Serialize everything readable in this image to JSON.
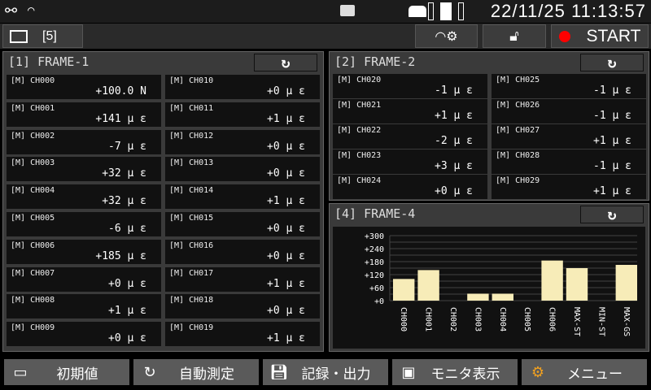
{
  "status": {
    "datetime": "22/11/25 11:13:57"
  },
  "toolbar": {
    "monitor_label": "[5]",
    "start_label": "START"
  },
  "frame1": {
    "title": "[1] FRAME-1",
    "cells": [
      {
        "name": "[M] CH000",
        "value": "+100.0 N"
      },
      {
        "name": "[M] CH001",
        "value": "+141 μ ε"
      },
      {
        "name": "[M] CH002",
        "value": "-7 μ ε"
      },
      {
        "name": "[M] CH003",
        "value": "+32 μ ε"
      },
      {
        "name": "[M] CH004",
        "value": "+32 μ ε"
      },
      {
        "name": "[M] CH005",
        "value": "-6 μ ε"
      },
      {
        "name": "[M] CH006",
        "value": "+185 μ ε"
      },
      {
        "name": "[M] CH007",
        "value": "+0 μ ε"
      },
      {
        "name": "[M] CH008",
        "value": "+1 μ ε"
      },
      {
        "name": "[M] CH009",
        "value": "+0 μ ε"
      },
      {
        "name": "[M] CH010",
        "value": "+0 μ ε"
      },
      {
        "name": "[M] CH011",
        "value": "+1 μ ε"
      },
      {
        "name": "[M] CH012",
        "value": "+0 μ ε"
      },
      {
        "name": "[M] CH013",
        "value": "+0 μ ε"
      },
      {
        "name": "[M] CH014",
        "value": "+1 μ ε"
      },
      {
        "name": "[M] CH015",
        "value": "+0 μ ε"
      },
      {
        "name": "[M] CH016",
        "value": "+0 μ ε"
      },
      {
        "name": "[M] CH017",
        "value": "+1 μ ε"
      },
      {
        "name": "[M] CH018",
        "value": "+0 μ ε"
      },
      {
        "name": "[M] CH019",
        "value": "+1 μ ε"
      }
    ]
  },
  "frame2": {
    "title": "[2] FRAME-2",
    "cells": [
      {
        "name": "[M] CH020",
        "value": "-1 μ ε"
      },
      {
        "name": "[M] CH021",
        "value": "+1 μ ε"
      },
      {
        "name": "[M] CH022",
        "value": "-2 μ ε"
      },
      {
        "name": "[M] CH023",
        "value": "+3 μ ε"
      },
      {
        "name": "[M] CH024",
        "value": "+0 μ ε"
      },
      {
        "name": "[M] CH025",
        "value": "-1 μ ε"
      },
      {
        "name": "[M] CH026",
        "value": "-1 μ ε"
      },
      {
        "name": "[M] CH027",
        "value": "+1 μ ε"
      },
      {
        "name": "[M] CH028",
        "value": "-1 μ ε"
      },
      {
        "name": "[M] CH029",
        "value": "+1 μ ε"
      }
    ]
  },
  "frame4": {
    "title": "[4] FRAME-4"
  },
  "chart_data": {
    "type": "bar",
    "categories": [
      "CH000",
      "CH001",
      "CH002",
      "CH003",
      "CH004",
      "CH005",
      "CH006",
      "MAX-ST",
      "MIN-ST",
      "MAX-GS"
    ],
    "values": [
      100,
      141,
      0,
      32,
      32,
      0,
      185,
      150,
      0,
      165
    ],
    "ylim": [
      0,
      300
    ],
    "yticks": [
      "+0",
      "+60",
      "+120",
      "+180",
      "+240",
      "+300"
    ],
    "bar_color": "#f7ecb8"
  },
  "bottom": [
    "初期値",
    "自動測定",
    "記録・出力",
    "モニタ表示",
    "メニュー"
  ],
  "colors": {
    "record": "#ff0000",
    "menu_icon": "#f0a020"
  }
}
